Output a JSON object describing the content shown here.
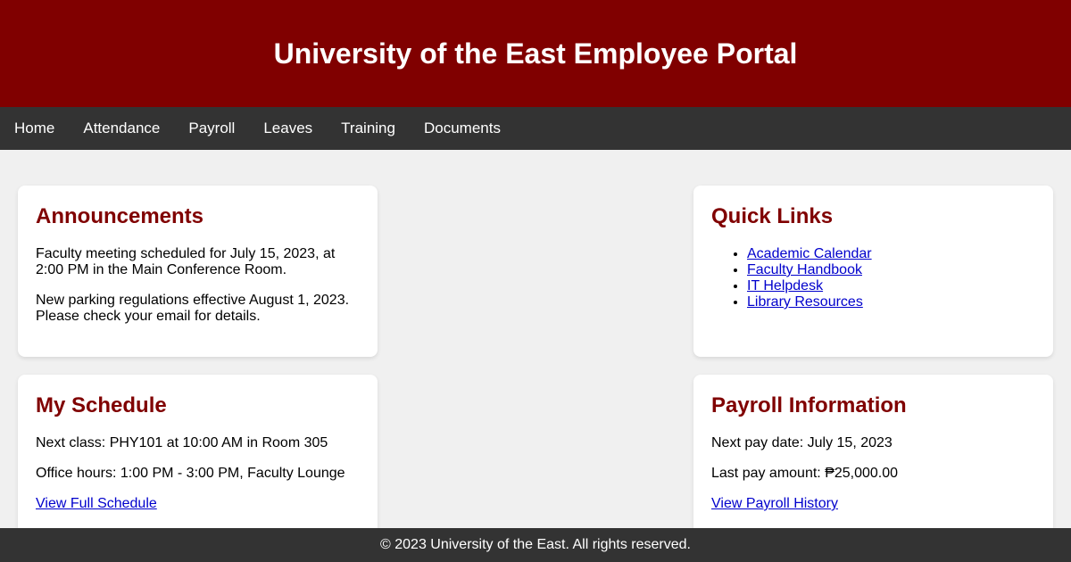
{
  "header": {
    "title": "University of the East Employee Portal"
  },
  "nav": {
    "items": [
      "Home",
      "Attendance",
      "Payroll",
      "Leaves",
      "Training",
      "Documents"
    ]
  },
  "announcements": {
    "title": "Announcements",
    "items": [
      "Faculty meeting scheduled for July 15, 2023, at 2:00 PM in the Main Conference Room.",
      "New parking regulations effective August 1, 2023. Please check your email for details."
    ]
  },
  "quick_links": {
    "title": "Quick Links",
    "items": [
      "Academic Calendar",
      "Faculty Handbook",
      "IT Helpdesk",
      "Library Resources"
    ]
  },
  "schedule": {
    "title": "My Schedule",
    "next_class": "Next class: PHY101 at 10:00 AM in Room 305",
    "office_hours": "Office hours: 1:00 PM - 3:00 PM, Faculty Lounge",
    "link": "View Full Schedule"
  },
  "payroll": {
    "title": "Payroll Information",
    "next_pay_date": "Next pay date: July 15, 2023",
    "last_pay_amount": "Last pay amount: ₱25,000.00",
    "link": "View Payroll History"
  },
  "footer": {
    "text": "© 2023 University of the East. All rights reserved."
  },
  "colors": {
    "brand": "#800000",
    "nav_bg": "#333333",
    "link": "#0000cc"
  }
}
